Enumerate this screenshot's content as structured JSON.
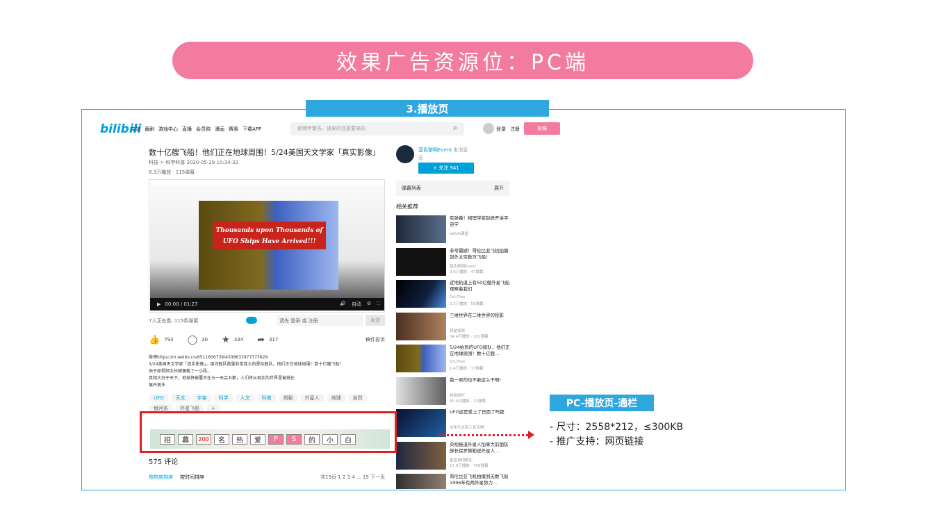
{
  "banner": {
    "title": "效果广告资源位：PC端"
  },
  "page_tag": "3.播放页",
  "site": {
    "logo": "bilibili",
    "nav": [
      "主站",
      "番剧",
      "游戏中心",
      "直播",
      "会员购",
      "漫画",
      "赛事",
      "下载APP"
    ],
    "search_placeholder": "疫情年警告，读来的还是要来的",
    "login": "登录",
    "register": "注册",
    "upload": "投稿"
  },
  "video": {
    "title": "数十亿艘飞船！他们正在地球周围！5/24美国天文学家「真实影像」",
    "meta": "科技 > 科学科普  2020-05-29 10:34:32",
    "stats": "8.3万播放 · 115弹幕",
    "overlay_text": "Thousands upon Thousands of UFO Ships Have Arrived!!!",
    "time": "00:00 / 01:27",
    "ctrl_labels": [
      "自动"
    ],
    "danmaku_online": "7人正在看, 115条弹幕",
    "danmaku_prompt": "请先 登录 或 注册",
    "danmaku_send": "发送",
    "likes": "793",
    "coins": "30",
    "favorites": "334",
    "shares": "317",
    "report": "稿件投诉",
    "description": [
      "微博https://m.weibo.cn/6511606739/4508633977373629",
      "5/24美国天文学家「真实影像」，银河舰队数量非常庞大的星际舰队。他们正在地球周围！数十亿艘飞船！",
      "由于原视频太长随便截了一小段。",
      "真相大白于天下，地球将被覆灭在五一天会五都，人们将从现实的世界里被排在"
    ],
    "expand": "展开更多",
    "tags": [
      "UFO",
      "天文",
      "宇宙",
      "科学",
      "人文",
      "科普",
      "揭秘",
      "外星人",
      "地球",
      "自然",
      "银河系",
      "外星飞船",
      "+"
    ],
    "comments_count": "575  评论",
    "sort_hot": "按热度排序",
    "sort_time": "按时间排序",
    "pager": "共19页  1  2  3  4  ...  19  下一页"
  },
  "sidebar": {
    "uploader": "蓝色黎明Event",
    "message": "发消息",
    "signature": "无",
    "follow": "+ 关注 941",
    "danmaku_list": "弹幕列表",
    "expand": "展开",
    "related_title": "相关推荐",
    "related": [
      {
        "title": "有弹幕！物理学家赵峥开讲宇宙学",
        "up": "bilibili课堂",
        "stats": ""
      },
      {
        "title": "非常震撼！哥伦比亚飞机拍摄到外太空数万飞船！",
        "up": "蓝色黎明Event",
        "stats": "3.6万播放 · 47弹幕"
      },
      {
        "title": "近地轨道上有50亿艘外星飞船观察着我们",
        "up": "DrLiTian",
        "stats": "3.3万播放 · 58弹幕"
      },
      {
        "title": "三维世界在二维世界的投影",
        "up": "我是视频",
        "stats": "34.4万播放 · 101弹幕"
      },
      {
        "title": "5/24拍到的UFO舰队，他们正在地球周围！数十亿艘...",
        "up": "DrLiTian",
        "stats": "1.4万播放 · 17弹幕"
      },
      {
        "title": "我一男的也不敢这么干啊!",
        "up": "林晓晓吖",
        "stats": "40.4万播放 · 23弹幕"
      },
      {
        "title": "UFO这是爱上了巴西了吗都",
        "up": "这年头去实人有点啊",
        "stats": ""
      },
      {
        "title": "央视报道外星人加拿大前国防部长保罗赫勒说外星人...",
        "up": "星盘真相察实",
        "stats": "17.6万播放 · 790弹幕"
      },
      {
        "title": "哥伦比亚飞机拍摄到无数飞船 1996年有两外星势力...",
        "up": "",
        "stats": ""
      }
    ]
  },
  "ad": {
    "chars": [
      "招",
      "募",
      "200",
      "名",
      "热",
      "爱",
      "P",
      "S",
      "的",
      "小",
      "白"
    ]
  },
  "slot": {
    "label": "PC-播放页-通栏",
    "specs": [
      "- 尺寸：2558*212，≤300KB",
      "- 推广支持：网页链接"
    ]
  },
  "colors": {
    "brand_pink": "#f47ba0",
    "blue": "#2ea7e0",
    "red": "#e02020"
  }
}
